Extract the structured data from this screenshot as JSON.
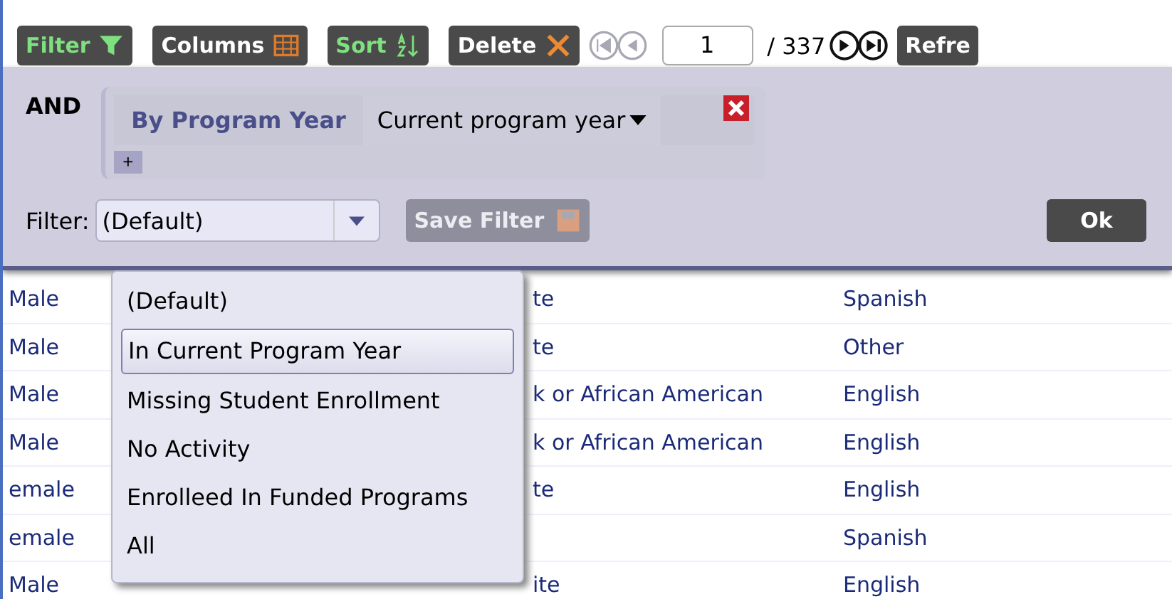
{
  "toolbar": {
    "buttons": [
      {
        "label": "Filter",
        "kind": "filter",
        "active": true
      },
      {
        "label": "Columns",
        "kind": "columns",
        "active": false
      },
      {
        "label": "Sort",
        "kind": "sort",
        "active": true
      },
      {
        "label": "Delete",
        "kind": "delete",
        "active": false
      }
    ],
    "pager": {
      "page": "1",
      "total": "/ 337"
    },
    "refresh": "Refre"
  },
  "filter_panel": {
    "operator": "AND",
    "condition": {
      "field": "By Program Year",
      "value": "Current program year"
    },
    "add": "+",
    "filter_label": "Filter:",
    "filter_value": "(Default)",
    "save": {
      "label": "Save Filter",
      "disabled": true
    },
    "ok": "Ok"
  },
  "dropdown": {
    "options": [
      {
        "label": "(Default)",
        "selected": false
      },
      {
        "label": "In Current Program Year",
        "selected": true
      },
      {
        "label": "Missing Student Enrollment",
        "selected": false
      },
      {
        "label": "No Activity",
        "selected": false
      },
      {
        "label": "Enrolleed In Funded Programs",
        "selected": false
      },
      {
        "label": "All",
        "selected": false
      }
    ]
  },
  "table": {
    "rows": [
      {
        "column_1": "Male",
        "column_3": "te",
        "column_4": "Spanish"
      },
      {
        "column_1": "Male",
        "column_3": "te",
        "column_4": "Other"
      },
      {
        "column_1": "Male",
        "column_3": "k or African American",
        "column_4": "English"
      },
      {
        "column_1": "Male",
        "column_3": "k or African American",
        "column_4": "English"
      },
      {
        "column_1": "emale",
        "column_3": "te",
        "column_4": "English"
      },
      {
        "column_1": "emale",
        "column_4": "Spanish"
      },
      {
        "column_1": "Male",
        "column_3": "ite",
        "column_4": "English"
      }
    ]
  }
}
